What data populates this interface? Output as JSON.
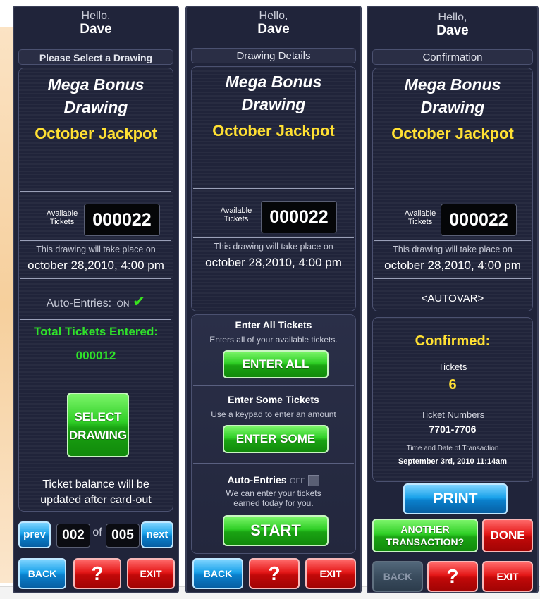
{
  "greeting": "Hello,",
  "user_name": "Dave",
  "drawing_title_line1": "Mega Bonus",
  "drawing_title_line2": "Drawing",
  "drawing_name": "October Jackpot",
  "available_label_line1": "Available",
  "available_label_line2": "Tickets",
  "available_count": "000022",
  "schedule_text": "This drawing will take place on",
  "schedule_date": "october 28,2010, 4:00 pm",
  "buttons": {
    "back": "BACK",
    "help": "?",
    "exit": "EXIT"
  },
  "screen1": {
    "subheader": "Please Select a Drawing",
    "auto_entries_label": "Auto-Entries:",
    "auto_entries_state": "ON",
    "total_label": "Total Tickets Entered:",
    "total_value": "000012",
    "select_line1": "SELECT",
    "select_line2": "DRAWING",
    "note_line1": "Ticket balance will be",
    "note_line2": "updated after card-out",
    "pager": {
      "prev": "prev",
      "current": "002",
      "of": "of",
      "total": "005",
      "next": "next"
    }
  },
  "screen2": {
    "subheader": "Drawing Details",
    "enter_all_title": "Enter All Tickets",
    "enter_all_desc": "Enters all of your available tickets.",
    "enter_all_button": "ENTER ALL",
    "enter_some_title": "Enter Some Tickets",
    "enter_some_desc": "Use a keypad to enter an amount",
    "enter_some_button": "ENTER SOME",
    "auto_title": "Auto-Entries",
    "auto_state": "OFF",
    "auto_desc_line1": "We can enter your tickets",
    "auto_desc_line2": "earned today for you.",
    "start_button": "START"
  },
  "screen3": {
    "subheader": "Confirmation",
    "autovar": "<AUTOVAR>",
    "confirmed": "Confirmed:",
    "tickets_label": "Tickets",
    "tickets_value": "6",
    "ticket_numbers_label": "Ticket Numbers",
    "ticket_numbers_value": "7701-7706",
    "time_label": "Time and Date of Transaction",
    "time_value": "September 3rd, 2010 11:14am",
    "print_button": "PRINT",
    "another_line1": "ANOTHER",
    "another_line2": "TRANSACTION?",
    "done_button": "DONE"
  },
  "colors": {
    "panel_bg": "#20243a",
    "accent_yellow": "#ffe033",
    "accent_green": "#2fcf26",
    "accent_red": "#e51818",
    "accent_blue": "#1aa2ea"
  }
}
